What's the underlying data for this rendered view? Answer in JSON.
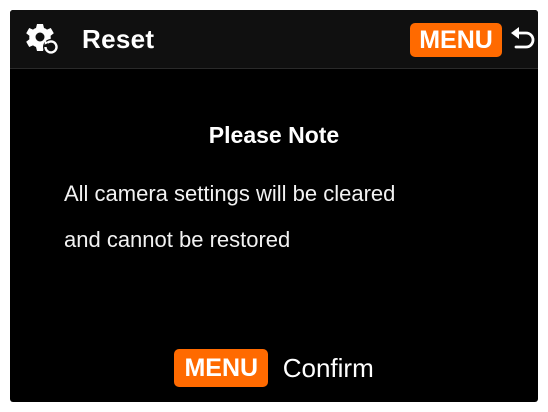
{
  "header": {
    "title": "Reset",
    "menu_badge": "MENU",
    "back_icon": "back-arrow-icon",
    "settings_icon": "gear-reset-icon"
  },
  "dialog": {
    "title": "Please Note",
    "message_line1": "All camera settings will be cleared",
    "message_line2": "and cannot be restored"
  },
  "footer": {
    "menu_badge": "MENU",
    "confirm_label": "Confirm"
  },
  "colors": {
    "background": "#000000",
    "header": "#101010",
    "accent": "#ff6a00",
    "text": "#ffffff"
  }
}
